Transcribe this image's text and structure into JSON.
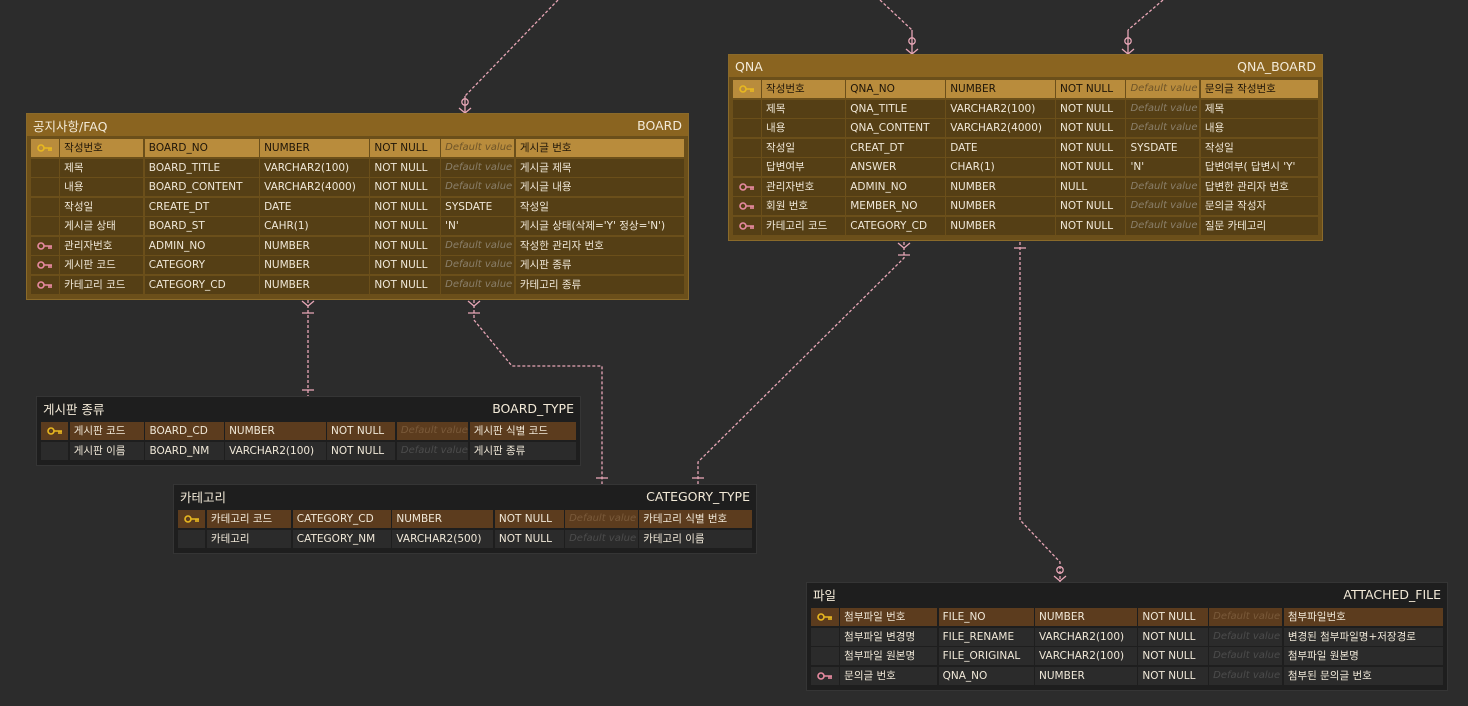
{
  "entities": [
    {
      "id": "board",
      "label": "공지사항/FAQ",
      "name": "BOARD",
      "style": "gold",
      "columns": [
        {
          "key": "pk",
          "logical": "작성번호",
          "physical": "BOARD_NO",
          "type": "NUMBER",
          "nullable": "NOT NULL",
          "default": "Default value",
          "comment": "게시글 번호"
        },
        {
          "key": "",
          "logical": "제목",
          "physical": "BOARD_TITLE",
          "type": "VARCHAR2(100)",
          "nullable": "NOT NULL",
          "default": "Default value",
          "comment": "게시글 제목"
        },
        {
          "key": "",
          "logical": "내용",
          "physical": "BOARD_CONTENT",
          "type": "VARCHAR2(4000)",
          "nullable": "NOT NULL",
          "default": "Default value",
          "comment": "게시글 내용"
        },
        {
          "key": "",
          "logical": "작성일",
          "physical": "CREATE_DT",
          "type": "DATE",
          "nullable": "NOT NULL",
          "default": "SYSDATE",
          "comment": "작성일"
        },
        {
          "key": "",
          "logical": "게시글 상태",
          "physical": "BOARD_ST",
          "type": "CAHR(1)",
          "nullable": "NOT NULL",
          "default": "'N'",
          "comment": "게시글 상태(삭제='Y' 정상='N')"
        },
        {
          "key": "fk",
          "logical": "관리자번호",
          "physical": "ADMIN_NO",
          "type": "NUMBER",
          "nullable": "NOT NULL",
          "default": "Default value",
          "comment": "작성한 관리자 번호"
        },
        {
          "key": "fk",
          "logical": "게시판 코드",
          "physical": "CATEGORY",
          "type": "NUMBER",
          "nullable": "NOT NULL",
          "default": "Default value",
          "comment": "게시판 종류"
        },
        {
          "key": "fk",
          "logical": "카테고리 코드",
          "physical": "CATEGORY_CD",
          "type": "NUMBER",
          "nullable": "NOT NULL",
          "default": "Default value",
          "comment": "카테고리 종류"
        }
      ]
    },
    {
      "id": "qna",
      "label": "QNA",
      "name": "QNA_BOARD",
      "style": "gold",
      "columns": [
        {
          "key": "pk",
          "logical": "작성번호",
          "physical": "QNA_NO",
          "type": "NUMBER",
          "nullable": "NOT NULL",
          "default": "Default value",
          "comment": "문의글 작성번호"
        },
        {
          "key": "",
          "logical": "제목",
          "physical": "QNA_TITLE",
          "type": "VARCHAR2(100)",
          "nullable": "NOT NULL",
          "default": "Default value",
          "comment": "제목"
        },
        {
          "key": "",
          "logical": "내용",
          "physical": "QNA_CONTENT",
          "type": "VARCHAR2(4000)",
          "nullable": "NOT NULL",
          "default": "Default value",
          "comment": "내용"
        },
        {
          "key": "",
          "logical": "작성일",
          "physical": "CREAT_DT",
          "type": "DATE",
          "nullable": "NOT NULL",
          "default": "SYSDATE",
          "comment": "작성일"
        },
        {
          "key": "",
          "logical": "답변여부",
          "physical": "ANSWER",
          "type": "CHAR(1)",
          "nullable": "NOT NULL",
          "default": "'N'",
          "comment": "답변여부( 답변시 'Y'"
        },
        {
          "key": "fk",
          "logical": "관리자번호",
          "physical": "ADMIN_NO",
          "type": "NUMBER",
          "nullable": "NULL",
          "default": "Default value",
          "comment": "답변한 관리자 번호"
        },
        {
          "key": "fk",
          "logical": "회원 번호",
          "physical": "MEMBER_NO",
          "type": "NUMBER",
          "nullable": "NOT NULL",
          "default": "Default value",
          "comment": "문의글 작성자"
        },
        {
          "key": "fk",
          "logical": "카테고리 코드",
          "physical": "CATEGORY_CD",
          "type": "NUMBER",
          "nullable": "NOT NULL",
          "default": "Default value",
          "comment": "질문 카테고리"
        }
      ]
    },
    {
      "id": "board_type",
      "label": "게시판 종류",
      "name": "BOARD_TYPE",
      "style": "dark",
      "columns": [
        {
          "key": "pk",
          "logical": "게시판 코드",
          "physical": "BOARD_CD",
          "type": "NUMBER",
          "nullable": "NOT NULL",
          "default": "Default value",
          "comment": "게시판 식별 코드"
        },
        {
          "key": "",
          "logical": "게시판 이름",
          "physical": "BOARD_NM",
          "type": "VARCHAR2(100)",
          "nullable": "NOT NULL",
          "default": "Default value",
          "comment": "게시판 종류"
        }
      ]
    },
    {
      "id": "category_type",
      "label": "카테고리",
      "name": "CATEGORY_TYPE",
      "style": "dark",
      "columns": [
        {
          "key": "pk",
          "logical": "카테고리 코드",
          "physical": "CATEGORY_CD",
          "type": "NUMBER",
          "nullable": "NOT NULL",
          "default": "Default value",
          "comment": "카테고리 식별 번호"
        },
        {
          "key": "",
          "logical": "카테고리",
          "physical": "CATEGORY_NM",
          "type": "VARCHAR2(500)",
          "nullable": "NOT NULL",
          "default": "Default value",
          "comment": "카테고리 이름"
        }
      ]
    },
    {
      "id": "attached_file",
      "label": "파일",
      "name": "ATTACHED_FILE",
      "style": "dark",
      "columns": [
        {
          "key": "pk",
          "logical": "첨부파일 번호",
          "physical": "FILE_NO",
          "type": "NUMBER",
          "nullable": "NOT NULL",
          "default": "Default value",
          "comment": "첨부파일번호"
        },
        {
          "key": "",
          "logical": "첨부파일 변경명",
          "physical": "FILE_RENAME",
          "type": "VARCHAR2(100)",
          "nullable": "NOT NULL",
          "default": "Default value",
          "comment": "변경된 첨부파일명+저장경로"
        },
        {
          "key": "",
          "logical": "첨부파일 원본명",
          "physical": "FILE_ORIGINAL",
          "type": "VARCHAR2(100)",
          "nullable": "NOT NULL",
          "default": "Default value",
          "comment": "첨부파일 원본명"
        },
        {
          "key": "fk",
          "logical": "문의글 번호",
          "physical": "QNA_NO",
          "type": "NUMBER",
          "nullable": "NOT NULL",
          "default": "Default value",
          "comment": "첨부된 문의글 번호"
        }
      ]
    }
  ],
  "relationships": [
    {
      "from": "board",
      "to": "board_type"
    },
    {
      "from": "board",
      "to": "category_type"
    },
    {
      "from": "qna",
      "to": "category_type"
    },
    {
      "from": "qna",
      "to": "attached_file"
    }
  ],
  "colors": {
    "connector": "#e7a6b6",
    "pk_key_icon": "#e8b820",
    "fk_key_icon": "#e78aa0"
  }
}
